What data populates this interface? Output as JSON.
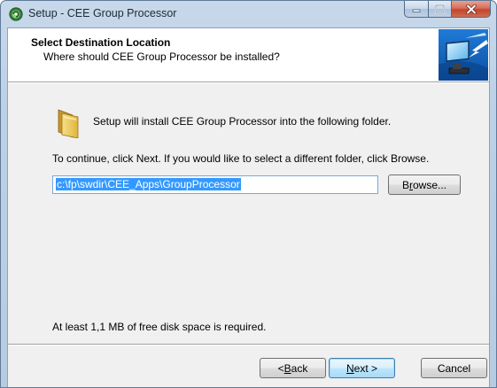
{
  "window": {
    "title": "Setup - CEE Group Processor"
  },
  "header": {
    "title": "Select Destination Location",
    "subtitle": "Where should CEE Group Processor be installed?"
  },
  "body": {
    "info": "Setup will install CEE Group Processor into the following folder.",
    "instruction": "To continue, click Next. If you would like to select a different folder, click Browse.",
    "path_value": "c:\\fp\\swdir\\CEE_Apps\\GroupProcessor",
    "browse_pre": "B",
    "browse_ul": "r",
    "browse_post": "owse...",
    "disk_space": "At least 1,1 MB of free disk space is required."
  },
  "footer": {
    "back_pre": "< ",
    "back_ul": "B",
    "back_post": "ack",
    "next_ul": "N",
    "next_post": "ext >",
    "cancel": "Cancel"
  },
  "icons": {
    "app": "setup-app-icon",
    "header": "computer-install-icon",
    "folder": "folder-icon"
  },
  "colors": {
    "selection": "#3399ff",
    "default_button_border": "#3c7fb1",
    "close_button": "#c2452b"
  }
}
